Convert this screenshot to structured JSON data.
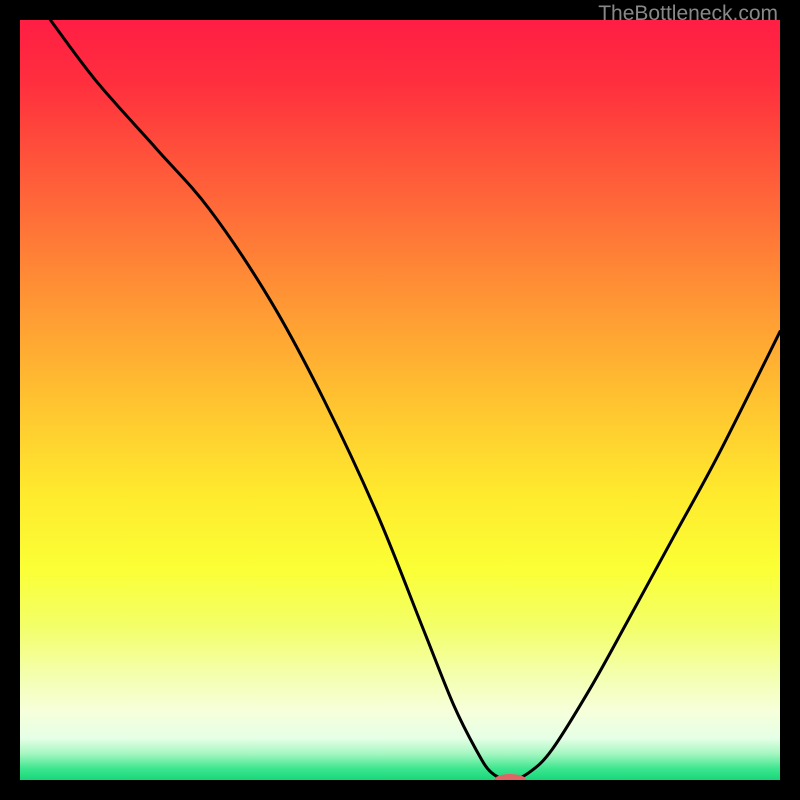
{
  "watermark": "TheBottleneck.com",
  "chart_data": {
    "type": "line",
    "title": "",
    "xlabel": "",
    "ylabel": "",
    "xlim": [
      0,
      100
    ],
    "ylim": [
      0,
      100
    ],
    "grid": false,
    "series": [
      {
        "name": "bottleneck-curve",
        "x": [
          4,
          10,
          18,
          25,
          33,
          40,
          47,
          53,
          57,
          60,
          62,
          64.5,
          67,
          70,
          75,
          80,
          86,
          92,
          100
        ],
        "y": [
          100,
          92,
          83,
          75,
          63,
          50,
          35,
          20,
          10,
          4,
          1,
          0,
          1,
          4,
          12,
          21,
          32,
          43,
          59
        ]
      }
    ],
    "marker": {
      "x": 64.5,
      "y": 0,
      "color": "#e06666",
      "rx": 16,
      "ry": 6
    },
    "gradient_stops": [
      {
        "offset": 0.0,
        "color": "#ff1e44"
      },
      {
        "offset": 0.08,
        "color": "#ff2e3e"
      },
      {
        "offset": 0.2,
        "color": "#ff593a"
      },
      {
        "offset": 0.35,
        "color": "#ff8f35"
      },
      {
        "offset": 0.5,
        "color": "#ffc230"
      },
      {
        "offset": 0.62,
        "color": "#ffe92e"
      },
      {
        "offset": 0.72,
        "color": "#fbff34"
      },
      {
        "offset": 0.8,
        "color": "#f3ff6a"
      },
      {
        "offset": 0.86,
        "color": "#f4ffac"
      },
      {
        "offset": 0.91,
        "color": "#f6ffdb"
      },
      {
        "offset": 0.945,
        "color": "#e6ffe6"
      },
      {
        "offset": 0.965,
        "color": "#a6f7c2"
      },
      {
        "offset": 0.985,
        "color": "#3de68f"
      },
      {
        "offset": 1.0,
        "color": "#18d67a"
      }
    ]
  }
}
